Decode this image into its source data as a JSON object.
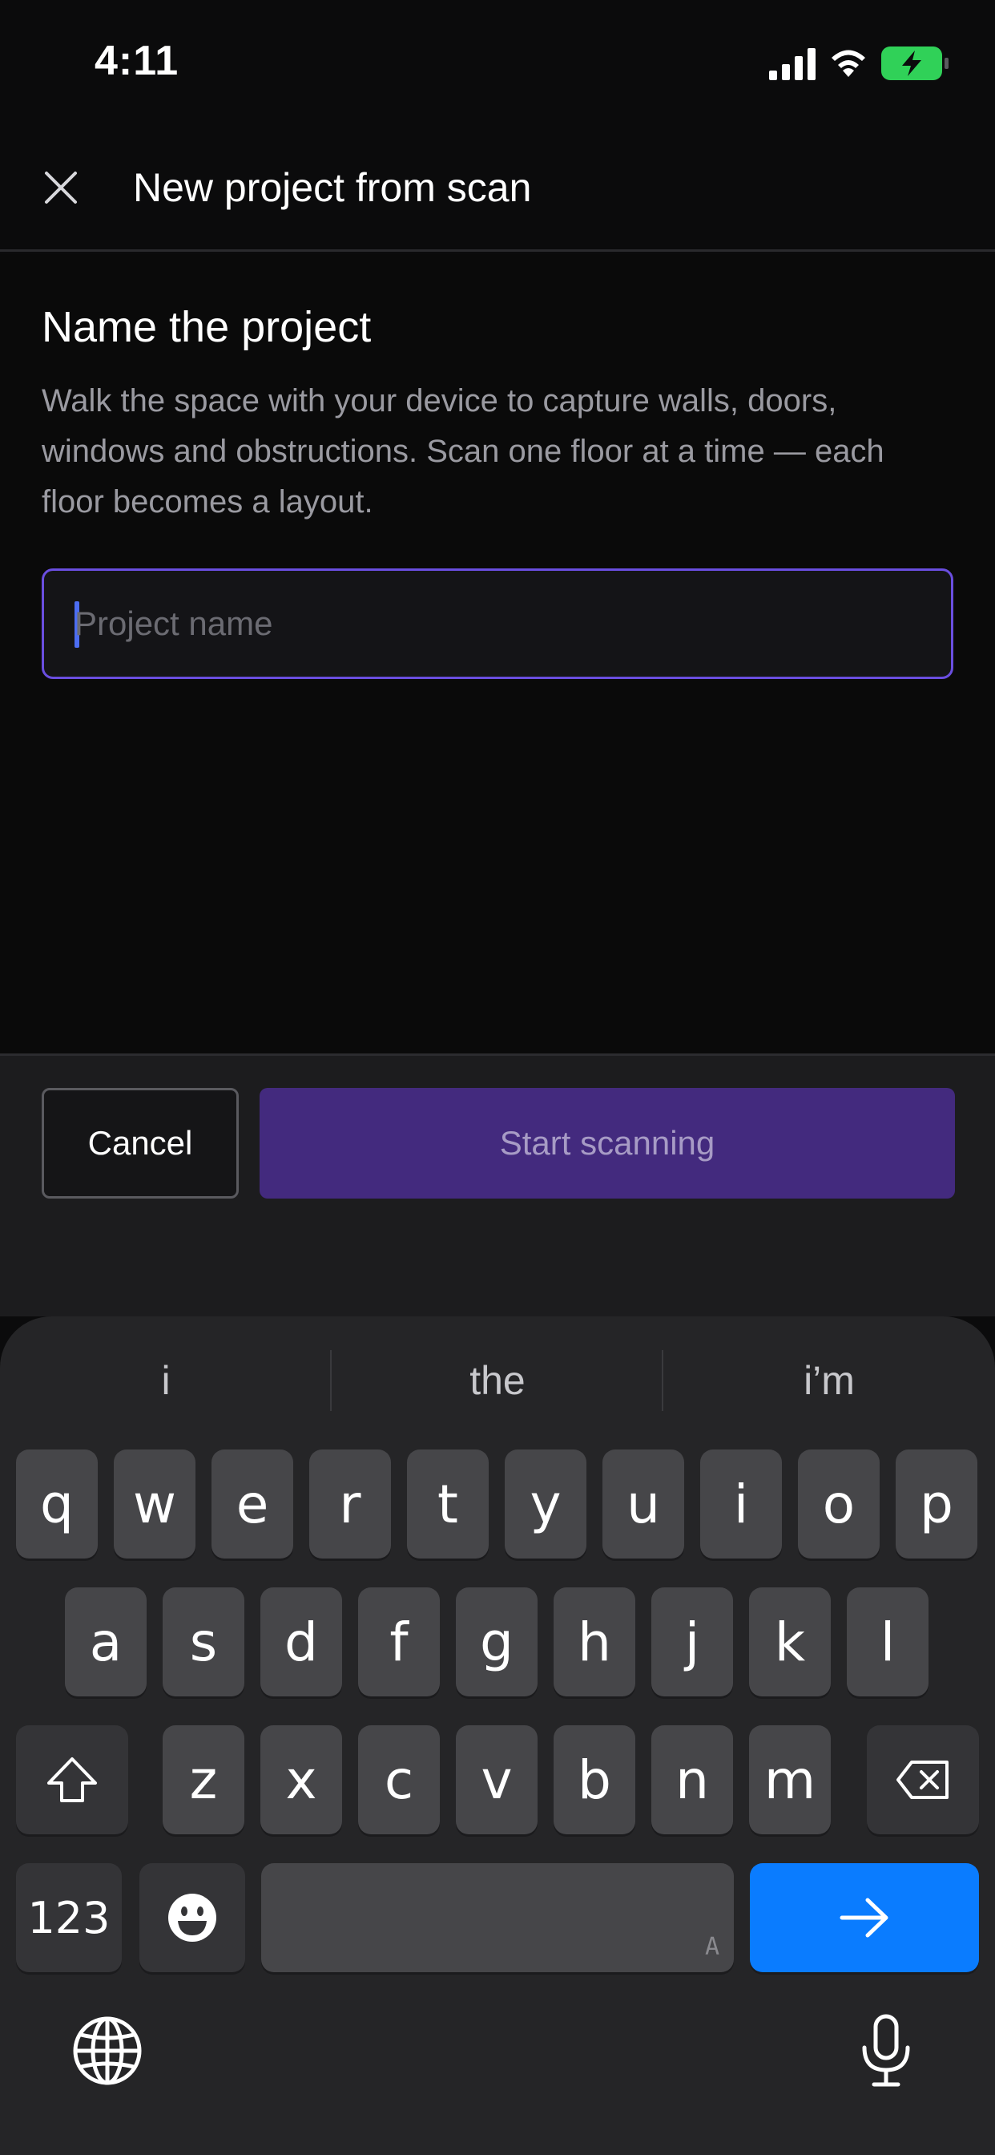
{
  "status_bar": {
    "time": "4:11",
    "battery_color": "#30d158",
    "icons": [
      "signal-icon",
      "wifi-icon",
      "battery-charging-icon"
    ]
  },
  "header": {
    "title": "New project from scan",
    "close_icon": "close-icon"
  },
  "content": {
    "title": "Name the project",
    "description": "Walk the space with your device to capture walls, doors, windows and obstructions. Scan one floor at a time — each floor becomes a layout.",
    "input": {
      "value": "",
      "placeholder": "Project name"
    }
  },
  "actions": {
    "cancel_label": "Cancel",
    "start_label": "Start scanning",
    "accent_color": "#432a7e"
  },
  "keyboard": {
    "suggestions": [
      "i",
      "the",
      "i’m"
    ],
    "row1": [
      "q",
      "w",
      "e",
      "r",
      "t",
      "y",
      "u",
      "i",
      "o",
      "p"
    ],
    "row2": [
      "a",
      "s",
      "d",
      "f",
      "g",
      "h",
      "j",
      "k",
      "l"
    ],
    "row3": [
      "z",
      "x",
      "c",
      "v",
      "b",
      "n",
      "m"
    ],
    "numbers_label": "123",
    "space_hint": "A",
    "go_color": "#0a7cff",
    "icons": [
      "shift-icon",
      "delete-icon",
      "emoji-icon",
      "arrow-right-icon",
      "globe-icon",
      "microphone-icon"
    ]
  }
}
